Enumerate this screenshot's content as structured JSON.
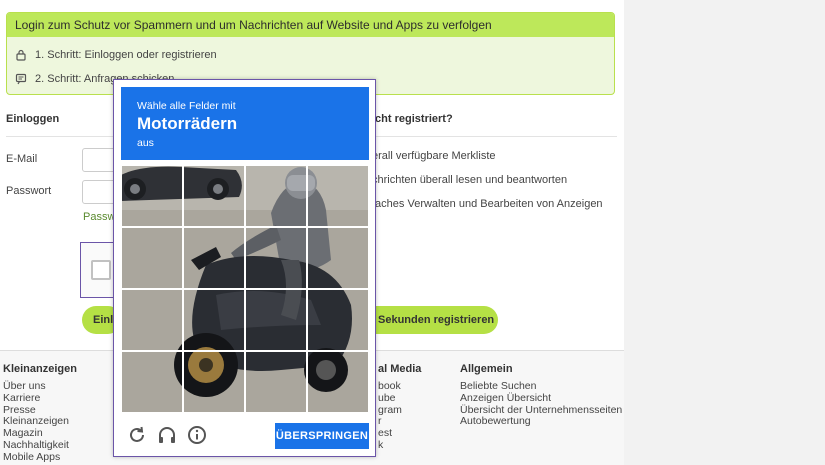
{
  "banner": {
    "title": "Login zum Schutz vor Spammern und um Nachrichten auf Website und Apps zu verfolgen",
    "step1": "1. Schritt: Einloggen oder registrieren",
    "step2": "2. Schritt: Anfragen schicken"
  },
  "login": {
    "heading": "Einloggen",
    "email_label": "E-Mail",
    "password_label": "Passwort",
    "forgot_link": "Passwo",
    "login_button": "Einlo"
  },
  "register": {
    "heading": "icht registriert?",
    "benefits": [
      "erall verfügbare Merkliste",
      "chrichten überall lesen und beantworten",
      "faches Verwalten und Bearbeiten von Anzeigen"
    ],
    "register_button": "Sekunden registrieren"
  },
  "footer": {
    "col1": {
      "heading": "Kleinanzeigen",
      "links": [
        "Über uns",
        "Karriere",
        "Presse",
        "Kleinanzeigen",
        "Magazin",
        "Nachhaltigkeit",
        "Mobile Apps"
      ]
    },
    "col2": {
      "heading": "al Media",
      "links": [
        "book",
        "ube",
        "gram",
        "r",
        "est",
        "k"
      ]
    },
    "col3": {
      "heading": "Allgemein",
      "links": [
        "Beliebte Suchen",
        "Anzeigen Übersicht",
        "Übersicht der Unternehmensseiten",
        "Autobewertung"
      ]
    }
  },
  "captcha": {
    "instruction_pre": "Wähle alle Felder mit",
    "target": "Motorrädern",
    "instruction_post": "aus",
    "grid_size": 4,
    "skip_button": "ÜBERSPRINGEN",
    "icons": [
      "reload-icon",
      "audio-icon",
      "info-icon"
    ],
    "header_color": "#1a73e8"
  },
  "colors": {
    "accent_green": "#b5e045",
    "banner_bg": "#eef7dd",
    "captcha_blue": "#1a73e8"
  }
}
